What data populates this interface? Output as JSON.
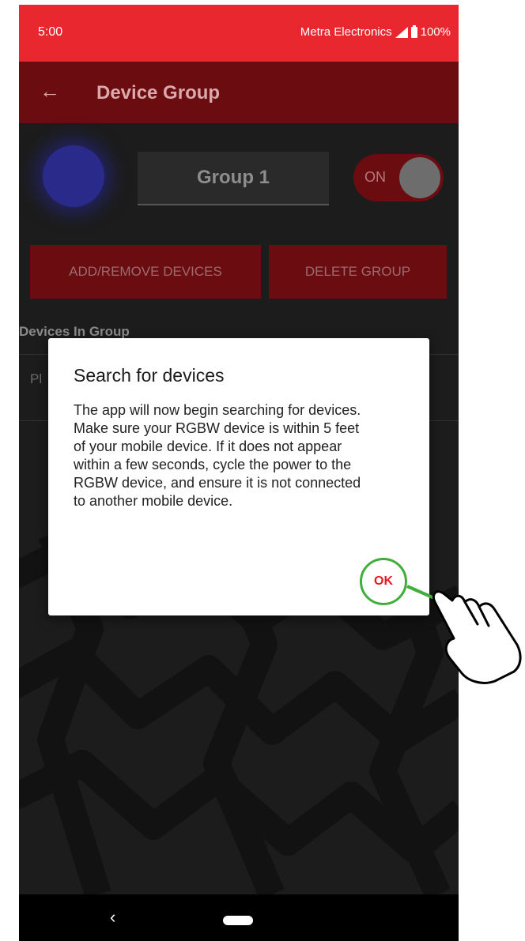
{
  "status_bar": {
    "time": "5:00",
    "carrier": "Metra Electronics",
    "battery": "100%"
  },
  "app_bar": {
    "title": "Device Group",
    "back_icon": "arrow-left-icon"
  },
  "group": {
    "name": "Group 1",
    "toggle_label": "ON",
    "color": "#2a2a8a"
  },
  "actions": {
    "add_remove": "ADD/REMOVE DEVICES",
    "delete": "DELETE GROUP"
  },
  "devices_section": {
    "header": "Devices In Group",
    "hint": "Pl"
  },
  "dialog": {
    "title": "Search for devices",
    "body": "The app will now begin searching for devices. Make sure your RGBW device is within 5 feet of your mobile device. If it does not appear within a few seconds, cycle the power to the RGBW device, and ensure it is not connected to another mobile device.",
    "ok_label": "OK"
  },
  "nav_bar": {
    "back_glyph": "‹"
  },
  "colors": {
    "status_bar": "#e8282e",
    "app_bar": "#6a0c10",
    "highlight_ring": "#3fae3a",
    "ok_text": "#e21b22"
  }
}
